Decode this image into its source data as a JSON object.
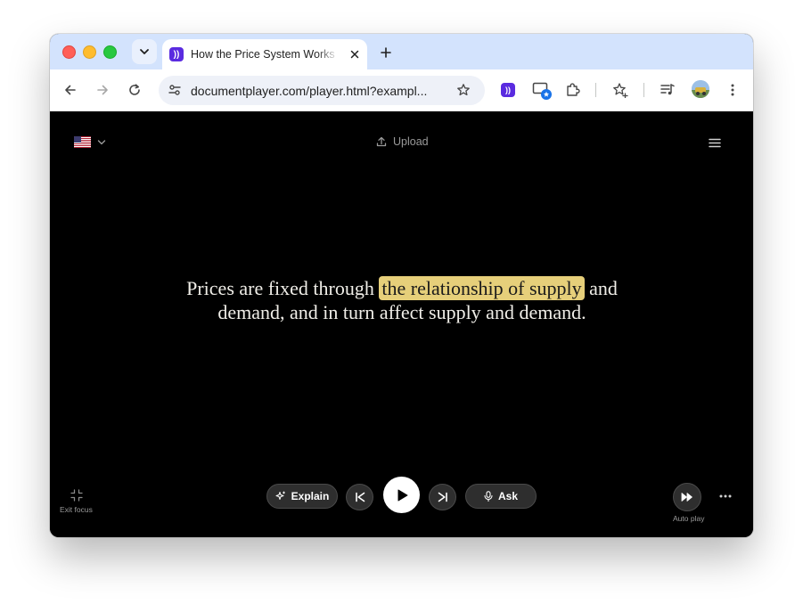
{
  "browser": {
    "tab_title": "How the Price System Works",
    "url": "documentplayer.com/player.html?exampl...",
    "new_tab_symbol": "+"
  },
  "player": {
    "upload_label": "Upload",
    "text": {
      "before": "Prices are fixed through ",
      "highlight": "the relationship of supply",
      "after": " and demand, and in turn affect supply and demand."
    },
    "controls": {
      "explain_label": "Explain",
      "ask_label": "Ask",
      "exit_focus_label": "Exit focus",
      "auto_play_label": "Auto play"
    },
    "colors": {
      "highlight": "#e6cf7a",
      "background": "#000000"
    }
  }
}
